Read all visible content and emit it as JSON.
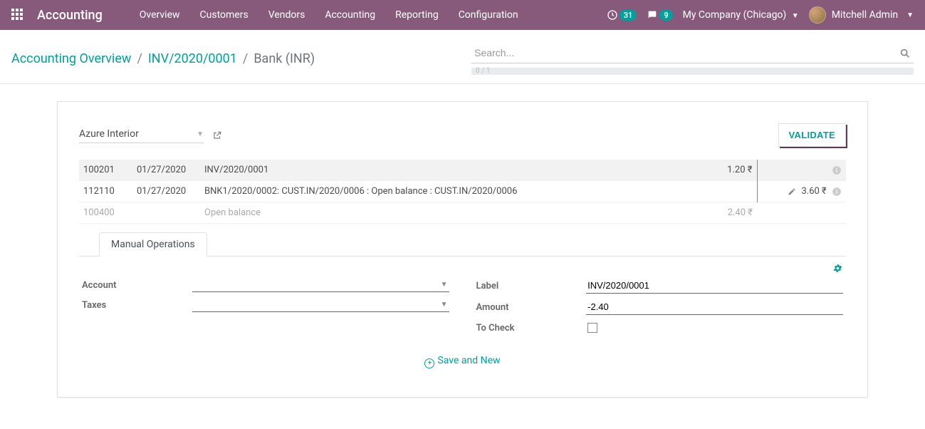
{
  "nav": {
    "brand": "Accounting",
    "menu": [
      "Overview",
      "Customers",
      "Vendors",
      "Accounting",
      "Reporting",
      "Configuration"
    ],
    "clock_badge": "31",
    "chat_badge": "9",
    "company": "My Company (Chicago)",
    "user": "Mitchell Admin"
  },
  "breadcrumbs": {
    "items": [
      "Accounting Overview",
      "INV/2020/0001",
      "Bank (INR)"
    ]
  },
  "search": {
    "placeholder": "Search...",
    "progress": "0 / 1"
  },
  "card": {
    "partner": "Azure Interior",
    "validate_label": "VALIDATE",
    "lines": [
      {
        "account": "100201",
        "date": "01/27/2020",
        "label": "INV/2020/0001",
        "amount": "1.20 ₹",
        "selected": true,
        "info": true
      },
      {
        "account": "112110",
        "date": "01/27/2020",
        "label": "BNK1/2020/0002: CUST.IN/2020/0006 : Open balance : CUST.IN/2020/0006",
        "amount": "",
        "row_amount": "3.60 ₹",
        "edit": true,
        "info": true
      },
      {
        "account": "100400",
        "date": "",
        "label": "Open balance",
        "amount": "2.40 ₹",
        "muted": true
      }
    ],
    "tab_label": "Manual Operations",
    "form": {
      "account_label": "Account",
      "taxes_label": "Taxes",
      "label_label": "Label",
      "label_value": "INV/2020/0001",
      "amount_label": "Amount",
      "amount_value": "-2.40",
      "tocheck_label": "To Check"
    },
    "save_new_label": "Save and New"
  }
}
